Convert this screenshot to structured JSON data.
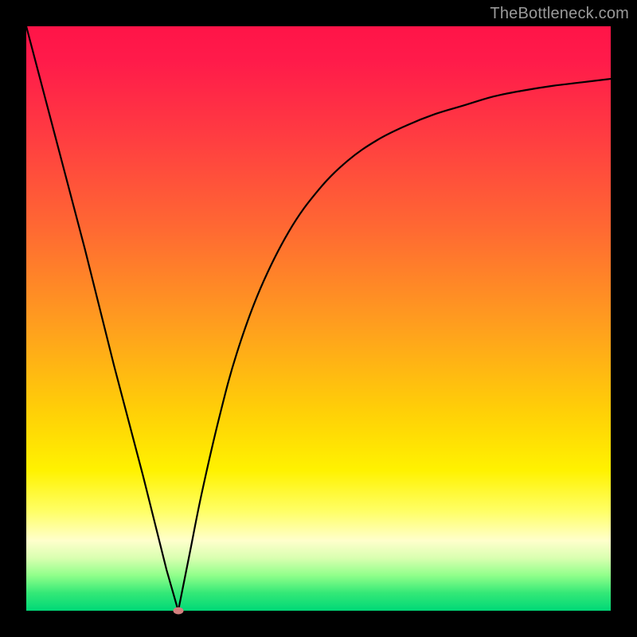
{
  "watermark": "TheBottleneck.com",
  "colors": {
    "frame": "#000000",
    "curve": "#000000",
    "min_marker": "#d47f7e",
    "gradient_stops": [
      "#ff1448",
      "#ff3a42",
      "#ff6a32",
      "#ffa11d",
      "#ffd007",
      "#fff200",
      "#ffff66",
      "#ffffcc",
      "#d9ffb0",
      "#8fff8a",
      "#33e877",
      "#00d877"
    ]
  },
  "chart_data": {
    "type": "line",
    "title": "",
    "xlabel": "",
    "ylabel": "",
    "xlim": [
      0,
      100
    ],
    "ylim": [
      0,
      100
    ],
    "grid": false,
    "legend": false,
    "annotations": [
      {
        "kind": "min_marker",
        "x": 26,
        "y": 0
      }
    ],
    "series": [
      {
        "name": "left-branch",
        "x": [
          0,
          5,
          10,
          15,
          20,
          24,
          26
        ],
        "values": [
          100,
          81,
          62,
          42,
          23,
          7,
          0
        ]
      },
      {
        "name": "right-branch",
        "x": [
          26,
          28,
          30,
          33,
          36,
          40,
          45,
          50,
          55,
          60,
          65,
          70,
          75,
          80,
          85,
          90,
          95,
          100
        ],
        "values": [
          0,
          10,
          20,
          33,
          44,
          55,
          65,
          72,
          77,
          80.5,
          83,
          85,
          86.5,
          88,
          89,
          89.8,
          90.4,
          91
        ]
      }
    ]
  }
}
